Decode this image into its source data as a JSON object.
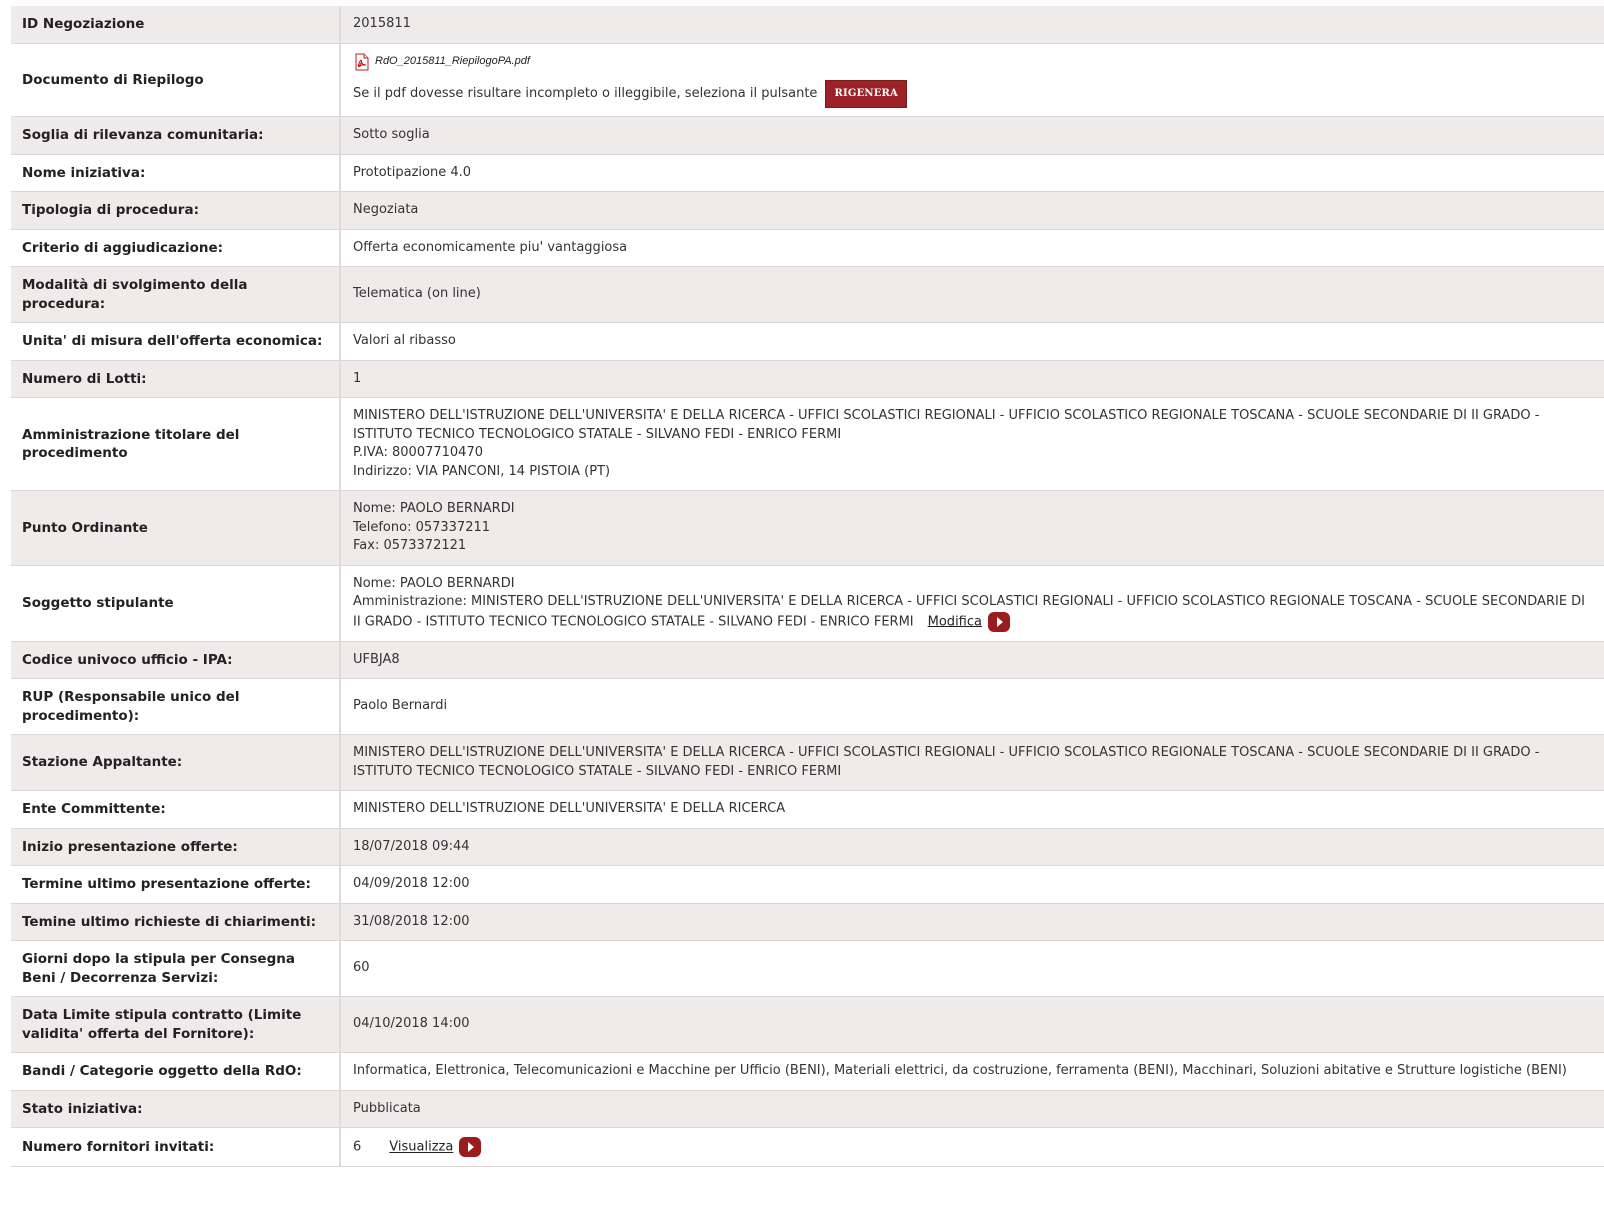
{
  "rows": {
    "id_negoziazione": {
      "label": "ID Negoziazione",
      "value": "2015811"
    },
    "documento": {
      "label": "Documento di Riepilogo",
      "file_name": "RdO_2015811_RiepilogoPA.pdf",
      "file_icon": "pdf-icon",
      "note": "Se il pdf dovesse risultare incompleto o illeggibile, seleziona il pulsante",
      "regen_label": "RIGENERA"
    },
    "soglia": {
      "label": "Soglia di rilevanza comunitaria:",
      "value": "Sotto soglia"
    },
    "nome_iniziativa": {
      "label": "Nome iniziativa:",
      "value": "Prototipazione 4.0"
    },
    "tipologia": {
      "label": "Tipologia di procedura:",
      "value": "Negoziata"
    },
    "criterio": {
      "label": "Criterio di aggiudicazione:",
      "value": "Offerta economicamente piu' vantaggiosa"
    },
    "modalita": {
      "label": "Modalità di svolgimento della procedura:",
      "value": "Telematica (on line)"
    },
    "unita_misura": {
      "label": "Unita' di misura dell'offerta economica:",
      "value": "Valori al ribasso"
    },
    "numero_lotti": {
      "label": "Numero di Lotti:",
      "value": "1"
    },
    "amministrazione": {
      "label": "Amministrazione titolare del procedimento",
      "name": "MINISTERO DELL'ISTRUZIONE DELL'UNIVERSITA' E DELLA RICERCA - UFFICI SCOLASTICI REGIONALI - UFFICIO SCOLASTICO REGIONALE TOSCANA - SCUOLE SECONDARIE DI II GRADO - ISTITUTO TECNICO TECNOLOGICO STATALE - SILVANO FEDI - ENRICO FERMI",
      "piva": "P.IVA: 80007710470",
      "indirizzo": "Indirizzo: VIA PANCONI, 14 PISTOIA (PT)"
    },
    "punto_ordinante": {
      "label": "Punto Ordinante",
      "nome": "Nome: PAOLO BERNARDI",
      "telefono": "Telefono: 057337211",
      "fax": "Fax: 0573372121"
    },
    "soggetto_stipulante": {
      "label": "Soggetto stipulante",
      "nome": "Nome: PAOLO BERNARDI",
      "amministrazione": "Amministrazione: MINISTERO DELL'ISTRUZIONE DELL'UNIVERSITA' E DELLA RICERCA - UFFICI SCOLASTICI REGIONALI - UFFICIO SCOLASTICO REGIONALE TOSCANA - SCUOLE SECONDARIE DI II GRADO - ISTITUTO TECNICO TECNOLOGICO STATALE - SILVANO FEDI - ENRICO FERMI",
      "modifica_label": "Modifica"
    },
    "codice_ipa": {
      "label": "Codice univoco ufficio - IPA:",
      "value": "UFBJA8"
    },
    "rup": {
      "label": "RUP (Responsabile unico del procedimento):",
      "value": "Paolo Bernardi"
    },
    "stazione": {
      "label": "Stazione Appaltante:",
      "value": "MINISTERO DELL'ISTRUZIONE DELL'UNIVERSITA' E DELLA RICERCA - UFFICI SCOLASTICI REGIONALI - UFFICIO SCOLASTICO REGIONALE TOSCANA - SCUOLE SECONDARIE DI II GRADO - ISTITUTO TECNICO TECNOLOGICO STATALE - SILVANO FEDI - ENRICO FERMI"
    },
    "ente": {
      "label": "Ente Committente:",
      "value": "MINISTERO DELL'ISTRUZIONE DELL'UNIVERSITA' E DELLA RICERCA"
    },
    "inizio": {
      "label": "Inizio presentazione offerte:",
      "value": "18/07/2018 09:44"
    },
    "termine": {
      "label": "Termine ultimo presentazione offerte:",
      "value": "04/09/2018 12:00"
    },
    "chiarimenti": {
      "label": "Temine ultimo richieste di chiarimenti:",
      "value": "31/08/2018 12:00"
    },
    "giorni": {
      "label": "Giorni dopo la stipula per Consegna Beni / Decorrenza Servizi:",
      "value": "60"
    },
    "data_limite": {
      "label": "Data Limite stipula contratto (Limite validita' offerta del Fornitore):",
      "value": "04/10/2018 14:00"
    },
    "bandi": {
      "label": "Bandi / Categorie oggetto della RdO:",
      "value": "Informatica, Elettronica, Telecomunicazioni e Macchine per Ufficio (BENI), Materiali elettrici, da costruzione, ferramenta (BENI), Macchinari, Soluzioni abitative e Strutture logistiche (BENI)"
    },
    "stato": {
      "label": "Stato iniziativa:",
      "value": "Pubblicata"
    },
    "fornitori": {
      "label": "Numero fornitori invitati:",
      "value": "6",
      "visualizza_label": "Visualizza"
    }
  },
  "colors": {
    "row_alt": "#efebeb",
    "accent_red": "#9b2226"
  }
}
